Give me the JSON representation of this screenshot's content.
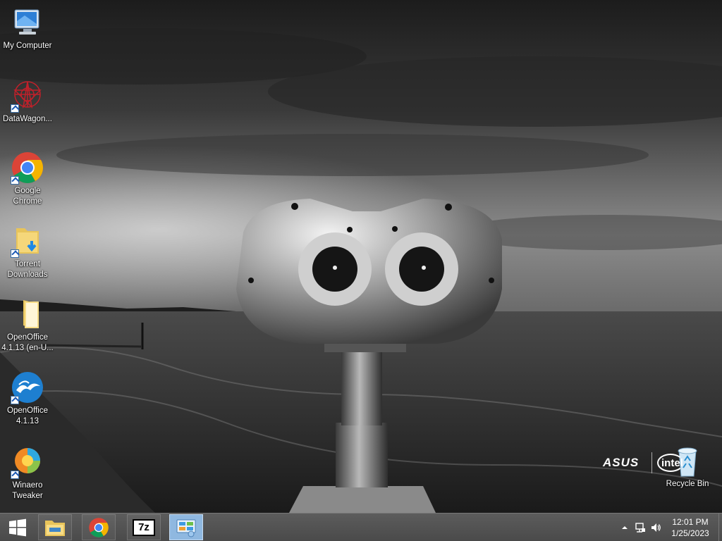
{
  "desktop": {
    "icons": [
      {
        "label": "My Computer",
        "icon": "my-computer-icon",
        "shortcut": false
      },
      {
        "label": "DataWagon...",
        "icon": "datawagon-icon",
        "shortcut": true
      },
      {
        "label": "Google\nChrome",
        "icon": "chrome-icon",
        "shortcut": true
      },
      {
        "label": "Torrent\nDownloads",
        "icon": "folder-download-icon",
        "shortcut": true
      },
      {
        "label": "OpenOffice\n4.1.13 (en-U...",
        "icon": "folder-icon",
        "shortcut": false
      },
      {
        "label": "OpenOffice\n4.1.13",
        "icon": "openoffice-icon",
        "shortcut": true
      },
      {
        "label": "Winaero\nTweaker",
        "icon": "winaero-tweaker-icon",
        "shortcut": true
      },
      {
        "label": "Recycle Bin",
        "icon": "recycle-bin-icon",
        "shortcut": false
      }
    ],
    "brand_asus": "ASUS",
    "brand_intel": "intel"
  },
  "taskbar": {
    "buttons": [
      {
        "name": "file-explorer",
        "icon": "file-explorer-icon",
        "active": false
      },
      {
        "name": "chrome",
        "icon": "chrome-icon",
        "active": false
      },
      {
        "name": "7zip",
        "icon": "7zip-icon",
        "active": false,
        "text": "7z"
      },
      {
        "name": "control-panel",
        "icon": "control-panel-icon",
        "active": true
      }
    ],
    "tray": {
      "show_hidden": "chevron-up-icon",
      "network": "network-icon",
      "volume": "speaker-icon",
      "time": "12:01 PM",
      "date": "1/25/2023"
    }
  },
  "colors": {
    "taskbar": "#505050",
    "active_task": "#8fb8e0"
  }
}
